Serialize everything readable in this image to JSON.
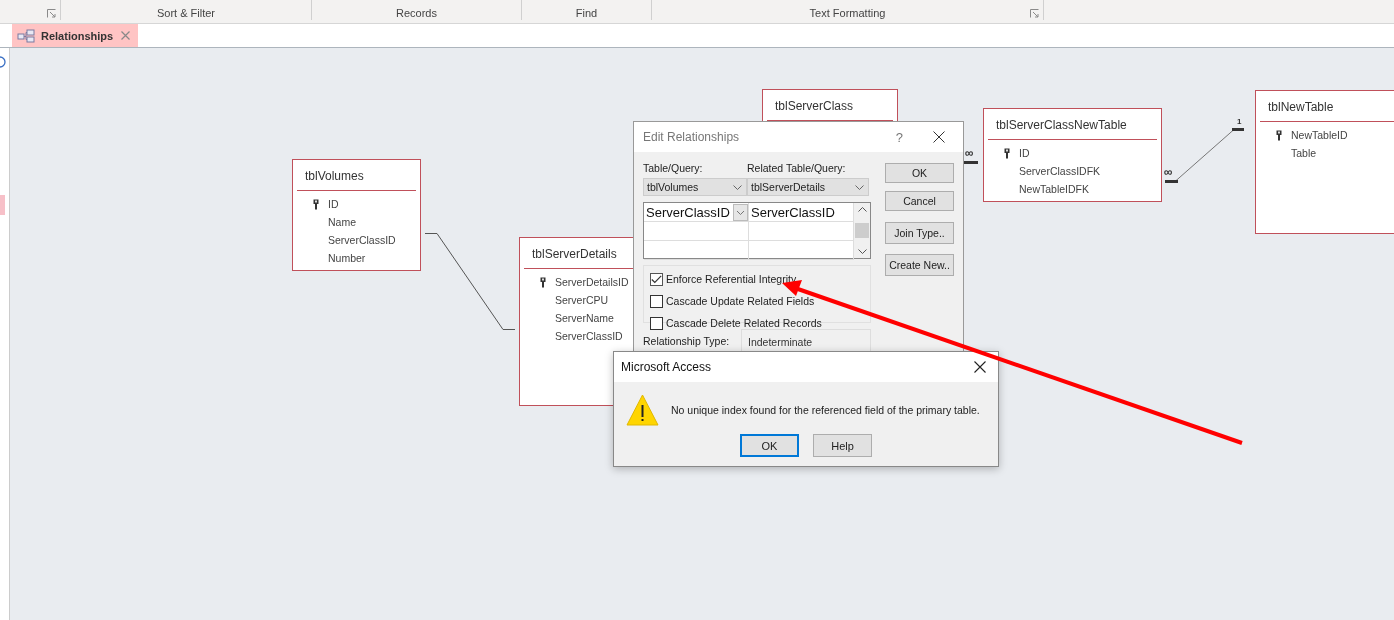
{
  "ribbon": {
    "groups": [
      {
        "launcher": true
      },
      {
        "label": "Sort & Filter",
        "launcher": false
      },
      {
        "label": "Records",
        "launcher": false
      },
      {
        "label": "Find",
        "launcher": false
      },
      {
        "label": "Text Formatting",
        "launcher": true
      }
    ]
  },
  "tabs": [
    {
      "label": "Relationships",
      "selected": true
    }
  ],
  "tables": [
    {
      "title": "tblVolumes",
      "fields": [
        {
          "name": "ID",
          "key": true
        },
        {
          "name": "Name",
          "key": false
        },
        {
          "name": "ServerClassID",
          "key": false
        },
        {
          "name": "Number",
          "key": false
        }
      ]
    },
    {
      "title": "tblServerDetails",
      "fields": [
        {
          "name": "ServerDetailsID",
          "key": true
        },
        {
          "name": "ServerCPU",
          "key": false
        },
        {
          "name": "ServerName",
          "key": false
        },
        {
          "name": "ServerClassID",
          "key": false
        }
      ]
    },
    {
      "title": "tblServerClass"
    },
    {
      "title": "tblServerClassNewTable",
      "fields": [
        {
          "name": "ID",
          "key": true
        },
        {
          "name": "ServerClassIDFK",
          "key": false
        },
        {
          "name": "NewTableIDFK",
          "key": false
        }
      ]
    },
    {
      "title": "tblNewTable",
      "fields": [
        {
          "name": "NewTableID",
          "key": true
        },
        {
          "name": "Table",
          "key": false
        }
      ]
    }
  ],
  "relationships": [
    {
      "kind": "plain"
    },
    {
      "kind": "one-to-many",
      "from_end": "∞",
      "to_end": "1"
    }
  ],
  "edit_dialog": {
    "title": "Edit Relationships",
    "help": "?",
    "table_label": "Table/Query:",
    "related_label": "Related Table/Query:",
    "table": "tblVolumes",
    "related_table": "tblServerDetails",
    "field_pairs": [
      {
        "field": "ServerClassID",
        "related_field": "ServerClassID"
      }
    ],
    "options": [
      {
        "label": "Enforce Referential Integrity",
        "checked": true
      },
      {
        "label": "Cascade Update Related Fields",
        "checked": false
      },
      {
        "label": "Cascade Delete Related Records",
        "checked": false
      }
    ],
    "buttons": [
      "OK",
      "Cancel",
      "Join Type..",
      "Create New.."
    ],
    "relationship_type_label": "Relationship Type:",
    "relationship_type": "Indeterminate",
    "side_end": "∞"
  },
  "message": {
    "title": "Microsoft Access",
    "text": "No unique index found for the referenced field of the primary table.",
    "buttons": [
      {
        "label": "OK",
        "default": true
      },
      {
        "label": "Help",
        "default": false
      }
    ]
  }
}
